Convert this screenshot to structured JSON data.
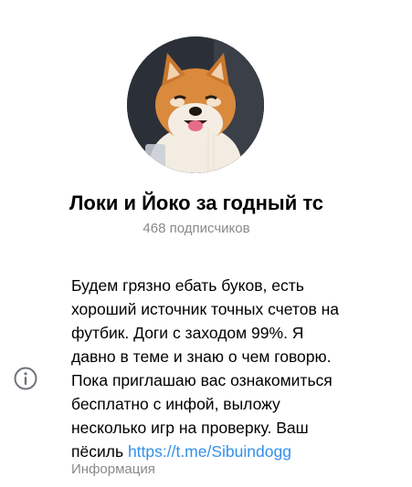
{
  "channel": {
    "title": "Локи и Йоко за годный тс",
    "subscribers": "468 подписчиков",
    "avatar": "shiba-inu-dog-photo"
  },
  "info": {
    "icon": "info-icon",
    "description_lines": [
      "Будем грязно ебать буков, есть",
      "хороший источник точных счетов на",
      "футбик. Доги с заходом 99%. Я",
      "давно в теме и знаю о чем говорю.",
      "Пока приглашаю вас ознакомиться",
      "бесплатно с инфой, выложу",
      "несколько игр на проверку. Ваш"
    ],
    "last_line_prefix": "пёсиль ",
    "link_text": "https://t.me/Sibuindogg",
    "label": "Информация"
  },
  "colors": {
    "link": "#3390ec",
    "secondary_text": "#8a8a8a",
    "primary_text": "#000000",
    "avatar_background": "#2b3038",
    "dog_fur": "#d98a3d"
  }
}
